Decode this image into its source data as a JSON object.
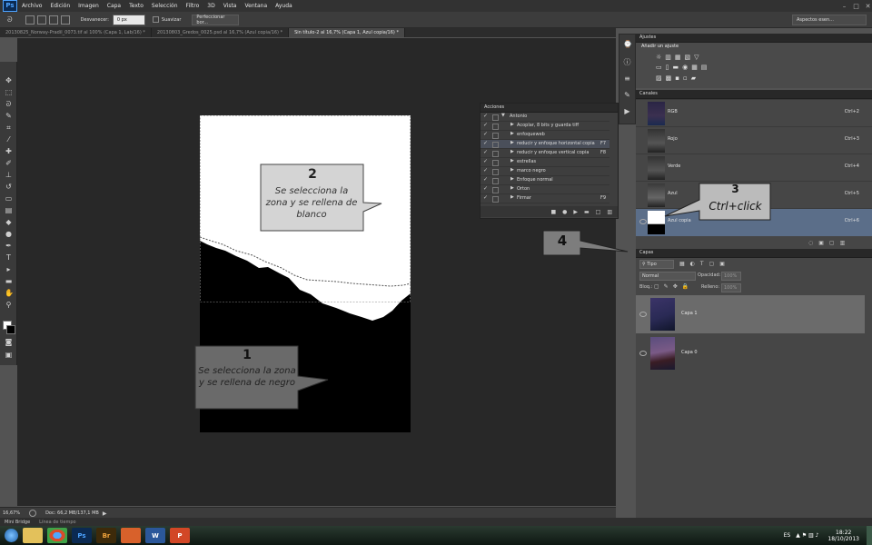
{
  "app": {
    "logo": "Ps"
  },
  "menu": [
    "Archivo",
    "Edición",
    "Imagen",
    "Capa",
    "Texto",
    "Selección",
    "Filtro",
    "3D",
    "Vista",
    "Ventana",
    "Ayuda"
  ],
  "options_bar": {
    "desvanecer_label": "Desvanecer:",
    "desvanecer_value": "0 px",
    "suavizar_label": "Suavizar",
    "refine_button": "Perfeccionar bor...",
    "workspace": "Aspectos esen..."
  },
  "doc_tabs": [
    {
      "label": "20130825_Norway-Pradil_0073.tif al 100% (Capa 1, Lab/16) *"
    },
    {
      "label": "20130803_Gredos_0025.psd al 16,7% (Azul copia/16) *"
    },
    {
      "label": "Sin título-2 al 16,7% (Capa 1, Azul copia/16) *"
    }
  ],
  "callouts": {
    "c1": {
      "number": "1",
      "text": "Se selecciona la zona y se rellena de negro"
    },
    "c2": {
      "number": "2",
      "text": "Se selecciona la zona y se rellena de blanco"
    },
    "c3": {
      "number": "3",
      "text": "Ctrl+click"
    },
    "c4": {
      "number": "4"
    }
  },
  "acciones": {
    "title": "Acciones",
    "rows": [
      {
        "label": "Antonio",
        "key": ""
      },
      {
        "label": "Acoplar, 8 bits y guarda tiff",
        "key": ""
      },
      {
        "label": "enfoqueweb",
        "key": ""
      },
      {
        "label": "reducir y enfoque horizontal copia",
        "key": "F7"
      },
      {
        "label": "reducir y enfoque vertical copia",
        "key": "F8"
      },
      {
        "label": "estrellas",
        "key": ""
      },
      {
        "label": "marco negro",
        "key": ""
      },
      {
        "label": "Enfoque normal",
        "key": ""
      },
      {
        "label": "Orton",
        "key": ""
      },
      {
        "label": "Firmar",
        "key": "F9"
      }
    ]
  },
  "ajustes": {
    "title": "Ajustes",
    "subtitle": "Añadir un ajuste"
  },
  "canales": {
    "title": "Canales",
    "rows": [
      {
        "name": "RGB",
        "key": "Ctrl+2"
      },
      {
        "name": "Rojo",
        "key": "Ctrl+3"
      },
      {
        "name": "Verde",
        "key": "Ctrl+4"
      },
      {
        "name": "Azul",
        "key": "Ctrl+5"
      },
      {
        "name": "Azul copia",
        "key": "Ctrl+6"
      }
    ]
  },
  "capas": {
    "title": "Capas",
    "filter": "Tipo",
    "blend": "Normal",
    "opacity_label": "Opacidad:",
    "opacity_value": "100%",
    "lock_label": "Bloq.:",
    "fill_label": "Relleno:",
    "fill_value": "100%",
    "layers": [
      {
        "name": "Capa 1"
      },
      {
        "name": "Capa 0"
      }
    ]
  },
  "status": {
    "zoom": "16,67%",
    "doc": "Doc: 66,2 MB/137,1 MB"
  },
  "bottom_tabs": [
    "Mini Bridge",
    "Línea de tiempo"
  ],
  "taskbar": {
    "lang": "ES",
    "time": "18:22",
    "date": "18/10/2013",
    "apps": [
      {
        "label": "",
        "color": "#3a77c9"
      },
      {
        "label": "",
        "color": "#e3c15b"
      },
      {
        "label": "",
        "color": "#d94b2b"
      },
      {
        "label": "Ps",
        "color": "#0b2a52"
      },
      {
        "label": "Br",
        "color": "#3d2a0a"
      },
      {
        "label": "",
        "color": "#d8612b"
      },
      {
        "label": "W",
        "color": "#2b579a"
      },
      {
        "label": "P",
        "color": "#d24726"
      }
    ]
  }
}
